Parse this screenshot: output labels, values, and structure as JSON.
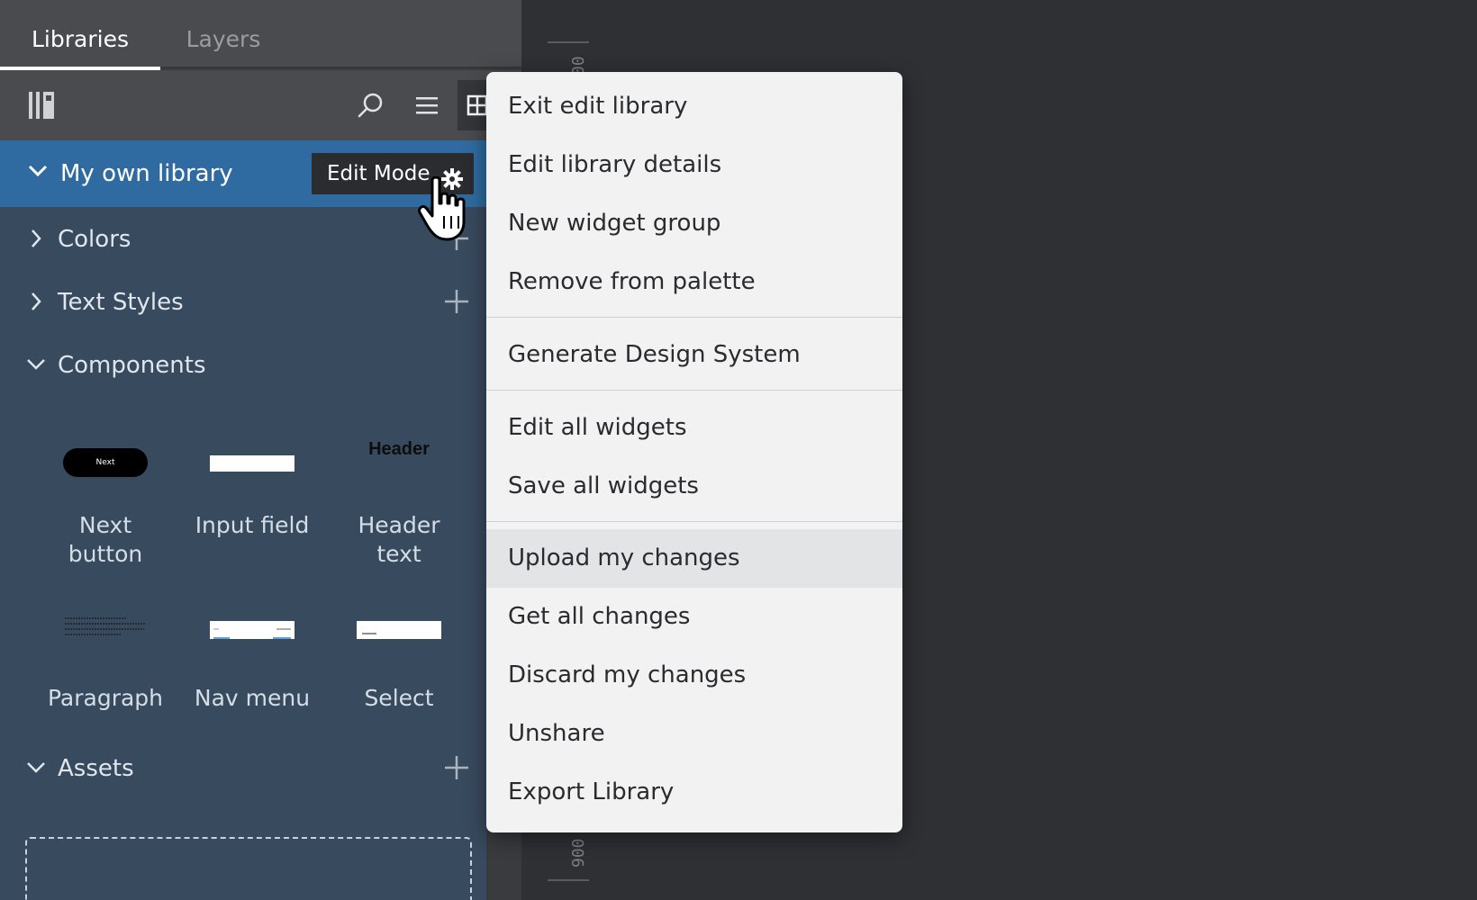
{
  "tabs": {
    "libraries": "Libraries",
    "layers": "Layers"
  },
  "library": {
    "title": "My own library",
    "edit_mode_label": "Edit Mode"
  },
  "sections": {
    "colors": "Colors",
    "text_styles": "Text Styles",
    "components": "Components",
    "assets": "Assets"
  },
  "components": [
    {
      "caption_line1": "Next",
      "caption_line2": "button",
      "thumb_text": "Next"
    },
    {
      "caption_line1": "Input field",
      "caption_line2": ""
    },
    {
      "caption_line1": "Header",
      "caption_line2": "text",
      "thumb_text": "Header"
    },
    {
      "caption_line1": "Paragraph",
      "caption_line2": ""
    },
    {
      "caption_line1": "Nav menu",
      "caption_line2": ""
    },
    {
      "caption_line1": "Select",
      "caption_line2": ""
    }
  ],
  "ruler": {
    "top_label": "00",
    "bottom_label": "900"
  },
  "menu": {
    "items": [
      "Exit edit library",
      "Edit library details",
      "New widget group",
      "Remove from palette",
      "Generate Design System",
      "Edit all widgets",
      "Save all widgets",
      "Upload my changes",
      "Get all changes",
      "Discard my changes",
      "Unshare",
      "Export Library"
    ],
    "highlighted": "Upload my changes"
  },
  "colors": {
    "panel_bg": "#384a5e",
    "header_accent": "#2f6ba0",
    "menu_bg": "#f2f2f3",
    "app_bg": "#2f3033"
  }
}
